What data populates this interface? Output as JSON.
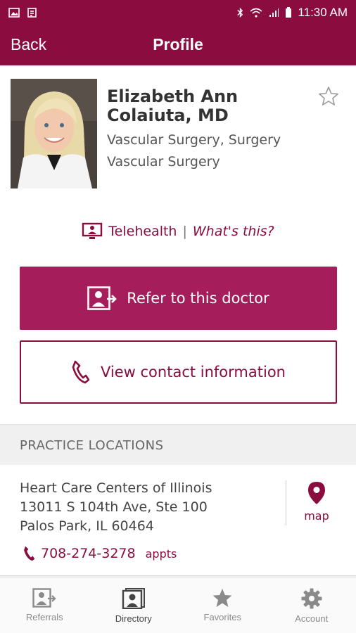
{
  "status_bar": {
    "time": "11:30 AM"
  },
  "header": {
    "back_label": "Back",
    "title": "Profile"
  },
  "doctor": {
    "name": "Elizabeth Ann Colaiuta, MD",
    "specialties": [
      "Vascular Surgery, Surgery",
      "Vascular Surgery"
    ]
  },
  "telehealth": {
    "label": "Telehealth",
    "separator": "|",
    "link": "What's this?"
  },
  "actions": {
    "refer_label": "Refer to this doctor",
    "contact_label": "View contact information"
  },
  "practice": {
    "header": "PRACTICE LOCATIONS",
    "location": {
      "lines": [
        "Heart Care Centers of Illinois",
        "13011 S 104th Ave, Ste 100",
        "Palos Park, IL 60464"
      ],
      "map_label": "map",
      "phone": "708-274-3278",
      "phone_note": "appts"
    }
  },
  "tabs": [
    {
      "label": "Referrals",
      "icon": "referrals-icon"
    },
    {
      "label": "Directory",
      "icon": "directory-icon",
      "active": true
    },
    {
      "label": "Favorites",
      "icon": "star-icon"
    },
    {
      "label": "Account",
      "icon": "gear-icon"
    }
  ],
  "colors": {
    "brand": "#8b0d3f",
    "button": "#a51d5a",
    "tab_inactive": "#8a8a8a"
  }
}
